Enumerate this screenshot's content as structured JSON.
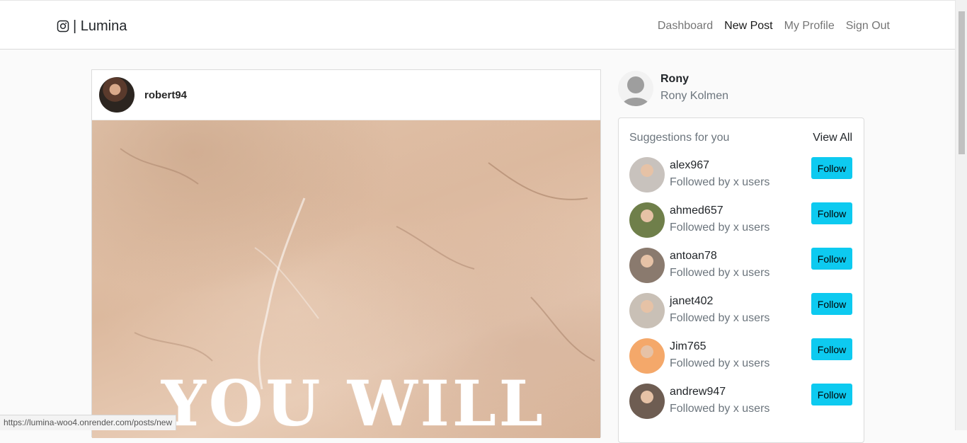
{
  "navbar": {
    "brand": "| Lumina",
    "brand_icon": "instagram-icon",
    "links": [
      "Dashboard",
      "New Post",
      "My Profile",
      "Sign Out"
    ]
  },
  "post": {
    "username": "robert94",
    "image_text": "YOU WILL"
  },
  "profile": {
    "username": "Rony",
    "full_name": "Rony Kolmen"
  },
  "suggestions": {
    "title": "Suggestions for you",
    "view_all": "View All",
    "follow_label": "Follow",
    "items": [
      {
        "username": "alex967",
        "subtitle": "Followed by x users",
        "avatar_color": "#c8c2bd"
      },
      {
        "username": "ahmed657",
        "subtitle": "Followed by x users",
        "avatar_color": "#6f7f4a"
      },
      {
        "username": "antoan78",
        "subtitle": "Followed by x users",
        "avatar_color": "#8a7a6e"
      },
      {
        "username": "janet402",
        "subtitle": "Followed by x users",
        "avatar_color": "#c9c0b6"
      },
      {
        "username": "Jim765",
        "subtitle": "Followed by x users",
        "avatar_color": "#f4a86a"
      },
      {
        "username": "andrew947",
        "subtitle": "Followed by x users",
        "avatar_color": "#6e5d52"
      }
    ]
  },
  "status_url": "https://lumina-woo4.onrender.com/posts/new"
}
